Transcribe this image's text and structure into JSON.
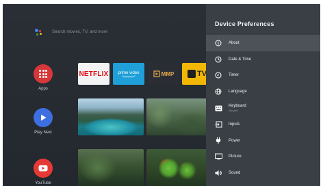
{
  "search": {
    "placeholder": "Search movies, TV, and more"
  },
  "rail": [
    {
      "label": "Apps",
      "icon": "apps-grid-icon",
      "color": "#d7373a"
    },
    {
      "label": "Play Next",
      "icon": "play-icon",
      "color": "#3d6fe0"
    },
    {
      "label": "YouTube",
      "icon": "youtube-icon",
      "color": "#e53935"
    }
  ],
  "apps_row": {
    "netflix": "NETFLIX",
    "prime": "prime video",
    "mmp": "MMP",
    "tv": "TV"
  },
  "panel": {
    "title": "Device Preferences",
    "items": [
      {
        "label": "About",
        "icon": "info-icon",
        "selected": true
      },
      {
        "label": "Date & Time",
        "icon": "clock-icon"
      },
      {
        "label": "Timer",
        "icon": "timer-icon"
      },
      {
        "label": "Language",
        "icon": "globe-icon"
      },
      {
        "label": "Keyboard",
        "sub": "Gboard",
        "icon": "keyboard-icon"
      },
      {
        "label": "Inputs",
        "icon": "input-icon"
      },
      {
        "label": "Power",
        "icon": "power-plug-icon"
      },
      {
        "label": "Picture",
        "icon": "monitor-icon"
      },
      {
        "label": "Sound",
        "icon": "speaker-icon"
      }
    ]
  },
  "colors": {
    "background": "#252a31",
    "panel": "#3a3f45",
    "selected_row": "#4d5258",
    "netflix_red": "#e50914",
    "prime_blue": "#1fa0d8",
    "tv_yellow": "#f2b705"
  }
}
